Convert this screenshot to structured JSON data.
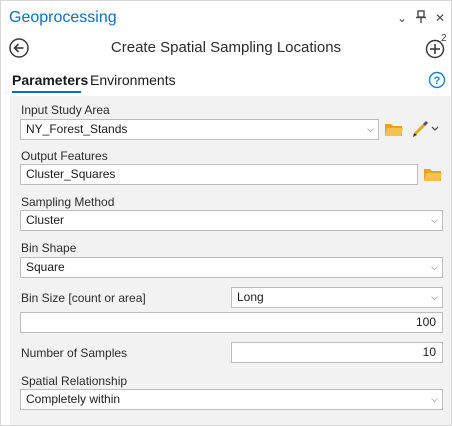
{
  "pane": {
    "title": "Geoprocessing",
    "controls": {
      "menu": "⌄",
      "pin": "⫯",
      "close": "✕"
    }
  },
  "tool": {
    "title": "Create Spatial Sampling Locations",
    "add_badge": "2"
  },
  "tabs": [
    {
      "label": "Parameters",
      "active": true
    },
    {
      "label": "Environments",
      "active": false
    }
  ],
  "params": {
    "input_study_area": {
      "label": "Input Study Area",
      "value": "NY_Forest_Stands"
    },
    "output_features": {
      "label": "Output Features",
      "value": "Cluster_Squares"
    },
    "sampling_method": {
      "label": "Sampling Method",
      "value": "Cluster"
    },
    "bin_shape": {
      "label": "Bin Shape",
      "value": "Square"
    },
    "bin_size": {
      "label": "Bin Size [count or area]",
      "unit": "Long",
      "value": "100"
    },
    "number_of_samples": {
      "label": "Number of Samples",
      "value": "10"
    },
    "spatial_relationship": {
      "label": "Spatial Relationship",
      "value": "Completely within"
    }
  },
  "colors": {
    "accent": "#0c6fb8",
    "folder": "#e0a526",
    "panel_bg": "#f2f2f2"
  },
  "icons": [
    "back-arrow-icon",
    "add-plus-icon",
    "help-icon",
    "folder-icon",
    "pencil-icon",
    "chevron-down-icon"
  ]
}
